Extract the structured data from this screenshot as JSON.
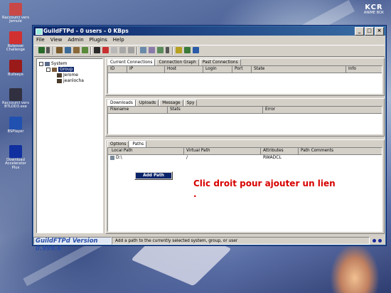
{
  "desktop": {
    "brand_logo": "KCR",
    "brand_sub": "ANIME BOX",
    "icons": [
      {
        "label": "Raccourci vers Jemule",
        "color": "#c84848"
      },
      {
        "label": "Ruleover Challenge",
        "color": "#d03030"
      },
      {
        "label": "Bullseye",
        "color": "#9a1a1a"
      },
      {
        "label": "Raccourci vers BTLOD3.exe",
        "color": "#303040"
      },
      {
        "label": "BSPlayer",
        "color": "#2050b0"
      },
      {
        "label": "Download Accelerator Plus",
        "color": "#1030a0"
      }
    ]
  },
  "window": {
    "title": "GuildFTPd - 0 users - 0 KBps",
    "menu": [
      "File",
      "View",
      "Admin",
      "Plugins",
      "Help"
    ]
  },
  "tree": {
    "root": "System",
    "group": "Group",
    "users": [
      "Jerome",
      "jeanlocha"
    ]
  },
  "connections": {
    "tabs": [
      "Current Connections",
      "Connection Graph",
      "Past Connections"
    ],
    "columns": [
      "ID",
      "IP",
      "Host",
      "Login",
      "Port",
      "State",
      "Info"
    ]
  },
  "transfers": {
    "tabs": [
      "Downloads",
      "Uploads",
      "Message",
      "Spy"
    ],
    "columns": [
      "Filename",
      "Stats",
      "Error"
    ]
  },
  "paths": {
    "tabs": [
      "Options",
      "Paths"
    ],
    "columns": [
      "Local Path",
      "Virtual Path",
      "Attributes",
      "Path Comments"
    ],
    "rows": [
      {
        "local": "D:\\",
        "virtual": "/",
        "attributes": "RWADCL",
        "comments": ""
      }
    ]
  },
  "context_menu": {
    "item": "Add Path"
  },
  "annotation": "Clic droit pour ajouter un lien .",
  "statusbar": {
    "version": "GuildFTPd Version 0.999.6",
    "message": "Add a path to the currently selected system, group, or user"
  }
}
